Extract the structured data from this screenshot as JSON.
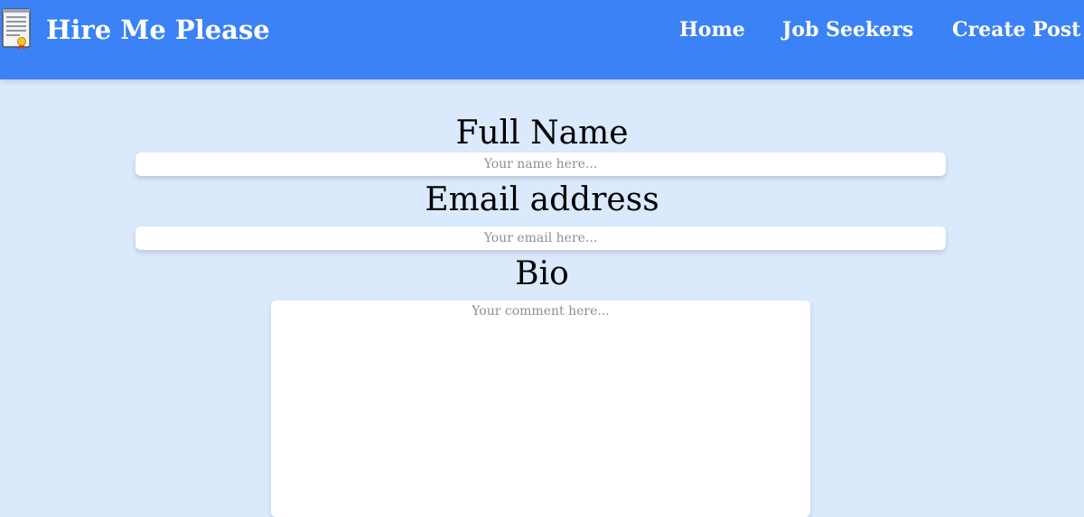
{
  "navbar": {
    "brand_title": "Hire Me Please",
    "brand_icon": "certificate-document-icon",
    "links": [
      {
        "label": "Home"
      },
      {
        "label": "Job Seekers"
      },
      {
        "label": "Create Post"
      }
    ],
    "background_color": "#3b82f6"
  },
  "form": {
    "full_name": {
      "label": "Full Name",
      "placeholder": "Your name here...",
      "value": ""
    },
    "email": {
      "label": "Email address",
      "placeholder": "Your email here...",
      "value": ""
    },
    "bio": {
      "label": "Bio",
      "placeholder": "Your comment here...",
      "value": ""
    }
  },
  "page_background_color": "#dbe9fd"
}
